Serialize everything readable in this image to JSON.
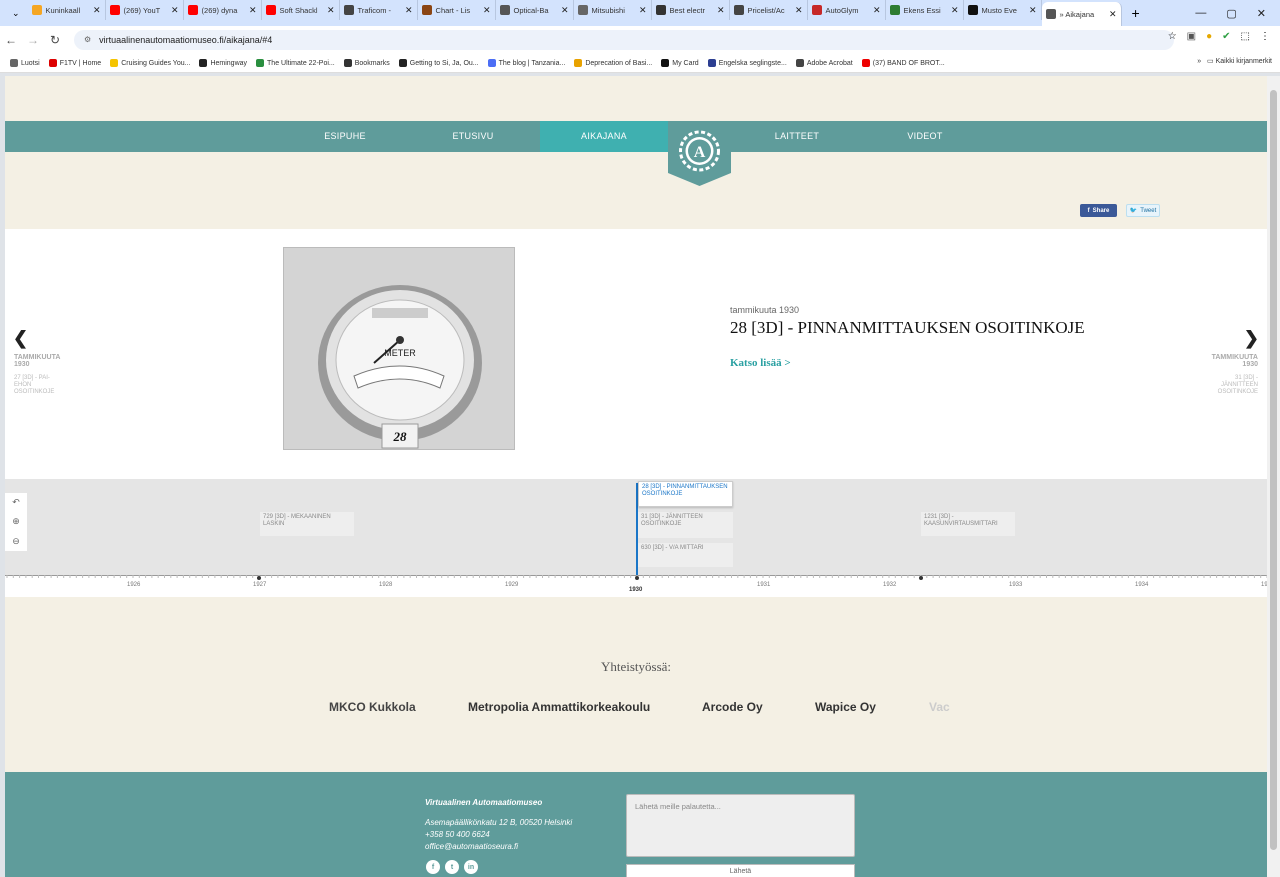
{
  "browser": {
    "tabs": [
      {
        "title": "Kuninkaall",
        "color": "#f5a623"
      },
      {
        "title": "(269) YouT",
        "color": "#ff0000"
      },
      {
        "title": "(269) dyna",
        "color": "#ff0000"
      },
      {
        "title": "Soft Shackl",
        "color": "#ff0000"
      },
      {
        "title": "Traficom -",
        "color": "#444444"
      },
      {
        "title": "Chart - Lis",
        "color": "#8b4513"
      },
      {
        "title": "Optical-Ba",
        "color": "#555555"
      },
      {
        "title": "Mitsubishi",
        "color": "#666666"
      },
      {
        "title": "Best electr",
        "color": "#333333"
      },
      {
        "title": "Pricelist/Ac",
        "color": "#444444"
      },
      {
        "title": "AutoGlym",
        "color": "#c62828"
      },
      {
        "title": "Ekens Essi",
        "color": "#2e7d32"
      },
      {
        "title": "Musto Eve",
        "color": "#111111"
      },
      {
        "title": "» Aikajana",
        "color": "#555555"
      }
    ],
    "url": "virtuaalinenautomaatiomuseo.fi/aikajana/#4",
    "bookmarks": [
      "Luotsi",
      "F1TV | Home",
      "Cruising Guides You...",
      "Hemingway",
      "The Ultimate 22-Poi...",
      "Bookmarks",
      "Getting to Si, Ja, Ou...",
      "The blog | Tanzania...",
      "Deprecation of Basi...",
      "My Card",
      "Engelska seglingste...",
      "Adobe Acrobat",
      "(37) BAND OF BROT..."
    ],
    "bookmarks_all": "Kaikki kirjanmerkit"
  },
  "nav": {
    "items": [
      "ESIPUHE",
      "ETUSIVU",
      "AIKAJANA",
      "LAITTEET",
      "VIDEOT"
    ],
    "active": "AIKAJANA"
  },
  "share": {
    "facebook": "Share",
    "twitter": "Tweet"
  },
  "slide": {
    "date": "tammikuuta 1930",
    "title": "28 [3D] - PINNANMITTAUKSEN OSOITINKOJE",
    "link": "Katso lisää >",
    "image_label": "METER",
    "image_tag": "28",
    "prev": {
      "date_line1": "TAMMIKUUTA",
      "date_line2": "1930",
      "desc": [
        "27 [3D] - PAI-",
        "EHON",
        "OSOITINKOJE"
      ]
    },
    "next": {
      "date_line1": "TAMMIKUUTA",
      "date_line2": "1930",
      "desc": [
        "31 [3D] -",
        "JÄNNITTEEN",
        "OSOITINKOJE"
      ]
    }
  },
  "timeline": {
    "cards": [
      {
        "text": "729 [3D] - MEKAANINEN LASKIN",
        "active": false
      },
      {
        "text": "28 [3D] - PINNANMITTAUKSEN OSOITINKOJE",
        "active": true
      },
      {
        "text": "31 [3D] - JÄNNITTEEN OSOITINKOJE",
        "active": false
      },
      {
        "text": "630 [3D] - V/A MITTARI",
        "active": false
      },
      {
        "text": "1231 [3D] - KAASUNVIRTAUSMITTARI",
        "active": false
      }
    ],
    "years": [
      "1926",
      "1927",
      "1928",
      "1929",
      "1930",
      "1931",
      "1932",
      "1933",
      "1934",
      "19"
    ],
    "current_year": "1930"
  },
  "partners": {
    "title": "Yhteistyössä:",
    "names": [
      "MKCO Kukkola",
      "Metropolia Ammattikorkeakoulu",
      "Arcode Oy",
      "Wapice Oy",
      "Vac"
    ]
  },
  "footer": {
    "org": "Virtuaalinen Automaatiomuseo",
    "address": "Asemapäällikönkatu 12 B,  00520 Helsinki",
    "phone": "+358 50 400 6624",
    "email": "office@automaatioseura.fi",
    "feedback_placeholder": "Lähetä meille palautetta...",
    "send": "Lähetä"
  },
  "colors": {
    "teal": "#5f9c9b",
    "active_teal": "#3fb0b0",
    "link": "#2aa0a2",
    "timeline_blue": "#1a76c8",
    "page_bg": "#f4f0e4"
  },
  "icons": [
    "chevron-down-icon",
    "back-icon",
    "forward-icon",
    "reload-icon",
    "star-icon",
    "zoom-in-icon",
    "zoom-out-icon",
    "facebook-icon",
    "twitter-icon",
    "linkedin-icon"
  ]
}
